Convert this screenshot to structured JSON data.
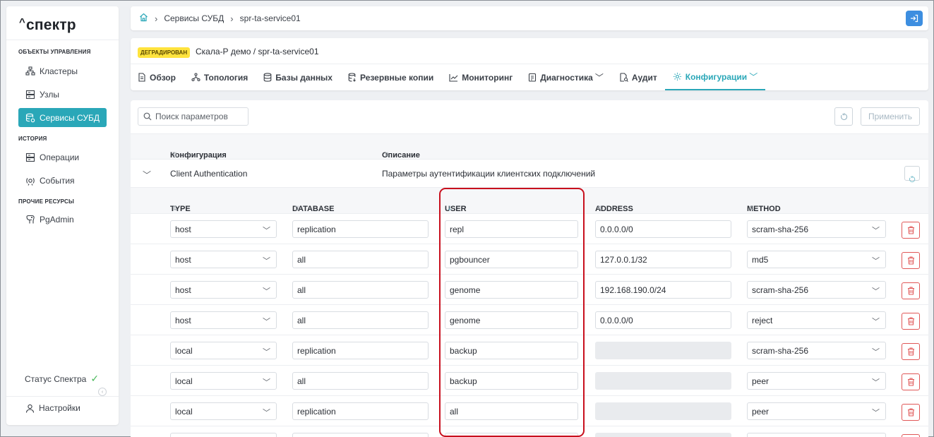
{
  "app": {
    "logo": "спектр"
  },
  "sidebar": {
    "sections": [
      {
        "title": "ОБЪЕКТЫ УПРАВЛЕНИЯ",
        "items": [
          {
            "label": "Кластеры",
            "icon": "cluster-icon"
          },
          {
            "label": "Узлы",
            "icon": "server-icon"
          },
          {
            "label": "Сервисы СУБД",
            "icon": "db-service-icon",
            "active": true
          }
        ]
      },
      {
        "title": "ИСТОРИЯ",
        "items": [
          {
            "label": "Операции",
            "icon": "operations-icon"
          },
          {
            "label": "События",
            "icon": "events-icon"
          }
        ]
      },
      {
        "title": "ПРОЧИЕ РЕСУРСЫ",
        "items": [
          {
            "label": "PgAdmin",
            "icon": "elephant-icon"
          }
        ]
      }
    ],
    "status_label": "Статус Спектра",
    "settings_label": "Настройки"
  },
  "breadcrumb": {
    "items": [
      "Сервисы СУБД",
      "spr-ta-service01"
    ]
  },
  "header": {
    "badge": "ДЕГРАДИРОВАН",
    "path": "Скала-Р демо /  spr-ta-service01",
    "tabs": [
      {
        "label": "Обзор",
        "icon": "document-icon"
      },
      {
        "label": "Топология",
        "icon": "topology-icon"
      },
      {
        "label": "Базы данных",
        "icon": "database-icon"
      },
      {
        "label": "Резервные копии",
        "icon": "backup-icon"
      },
      {
        "label": "Мониторинг",
        "icon": "chart-icon"
      },
      {
        "label": "Диагностика",
        "icon": "diagnostics-icon",
        "dropdown": true
      },
      {
        "label": "Аудит",
        "icon": "audit-icon"
      },
      {
        "label": "Конфигурации",
        "icon": "gear-icon",
        "dropdown": true,
        "active": true
      }
    ]
  },
  "toolbar": {
    "search_placeholder": "Поиск параметров",
    "apply_label": "Применить"
  },
  "config_table": {
    "columns": [
      "Конфигурация",
      "Описание"
    ],
    "group": {
      "name": "Client Authentication",
      "description": "Параметры аутентификации клиентских подключений"
    }
  },
  "auth_table": {
    "columns": [
      "TYPE",
      "DATABASE",
      "USER",
      "ADDRESS",
      "METHOD"
    ],
    "rows": [
      {
        "type": "host",
        "database": "replication",
        "user": "repl",
        "address": "0.0.0.0/0",
        "method": "scram-sha-256"
      },
      {
        "type": "host",
        "database": "all",
        "user": "pgbouncer",
        "address": "127.0.0.1/32",
        "method": "md5"
      },
      {
        "type": "host",
        "database": "all",
        "user": "genome",
        "address": "192.168.190.0/24",
        "method": "scram-sha-256"
      },
      {
        "type": "host",
        "database": "all",
        "user": "genome",
        "address": "0.0.0.0/0",
        "method": "reject"
      },
      {
        "type": "local",
        "database": "replication",
        "user": "backup",
        "address": "",
        "method": "scram-sha-256"
      },
      {
        "type": "local",
        "database": "all",
        "user": "backup",
        "address": "",
        "method": "peer"
      },
      {
        "type": "local",
        "database": "replication",
        "user": "all",
        "address": "",
        "method": "peer"
      }
    ]
  },
  "colors": {
    "accent": "#2aa7b8",
    "badge": "#ffe33d",
    "danger": "#e05757",
    "highlight": "#c8101e"
  }
}
